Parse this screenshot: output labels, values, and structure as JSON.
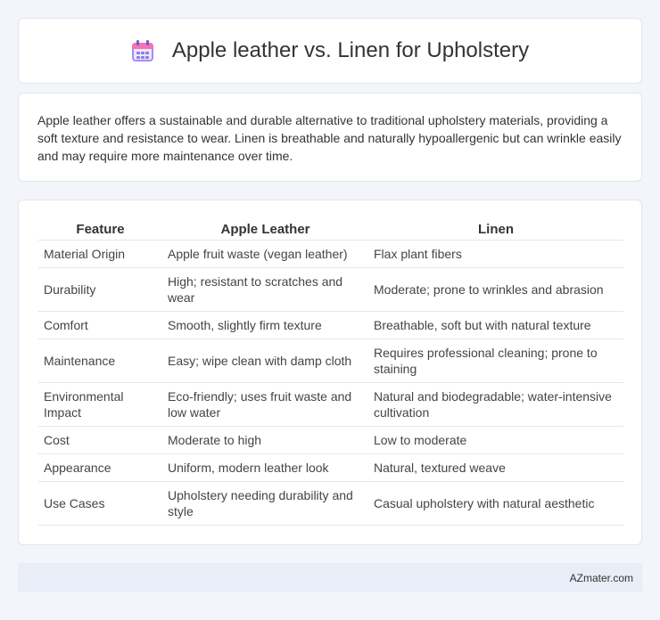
{
  "header": {
    "title": "Apple leather vs. Linen for Upholstery",
    "icon": "calendar-icon"
  },
  "description": "Apple leather offers a sustainable and durable alternative to traditional upholstery materials, providing a soft texture and resistance to wear. Linen is breathable and naturally hypoallergenic but can wrinkle easily and may require more maintenance over time.",
  "table": {
    "columns": [
      "Feature",
      "Apple Leather",
      "Linen"
    ],
    "rows": [
      [
        "Material Origin",
        "Apple fruit waste (vegan leather)",
        "Flax plant fibers"
      ],
      [
        "Durability",
        "High; resistant to scratches and wear",
        "Moderate; prone to wrinkles and abrasion"
      ],
      [
        "Comfort",
        "Smooth, slightly firm texture",
        "Breathable, soft but with natural texture"
      ],
      [
        "Maintenance",
        "Easy; wipe clean with damp cloth",
        "Requires professional cleaning; prone to staining"
      ],
      [
        "Environmental Impact",
        "Eco-friendly; uses fruit waste and low water",
        "Natural and biodegradable; water-intensive cultivation"
      ],
      [
        "Cost",
        "Moderate to high",
        "Low to moderate"
      ],
      [
        "Appearance",
        "Uniform, modern leather look",
        "Natural, textured weave"
      ],
      [
        "Use Cases",
        "Upholstery needing durability and style",
        "Casual upholstery with natural aesthetic"
      ]
    ]
  },
  "footer": {
    "source": "AZmater.com"
  }
}
